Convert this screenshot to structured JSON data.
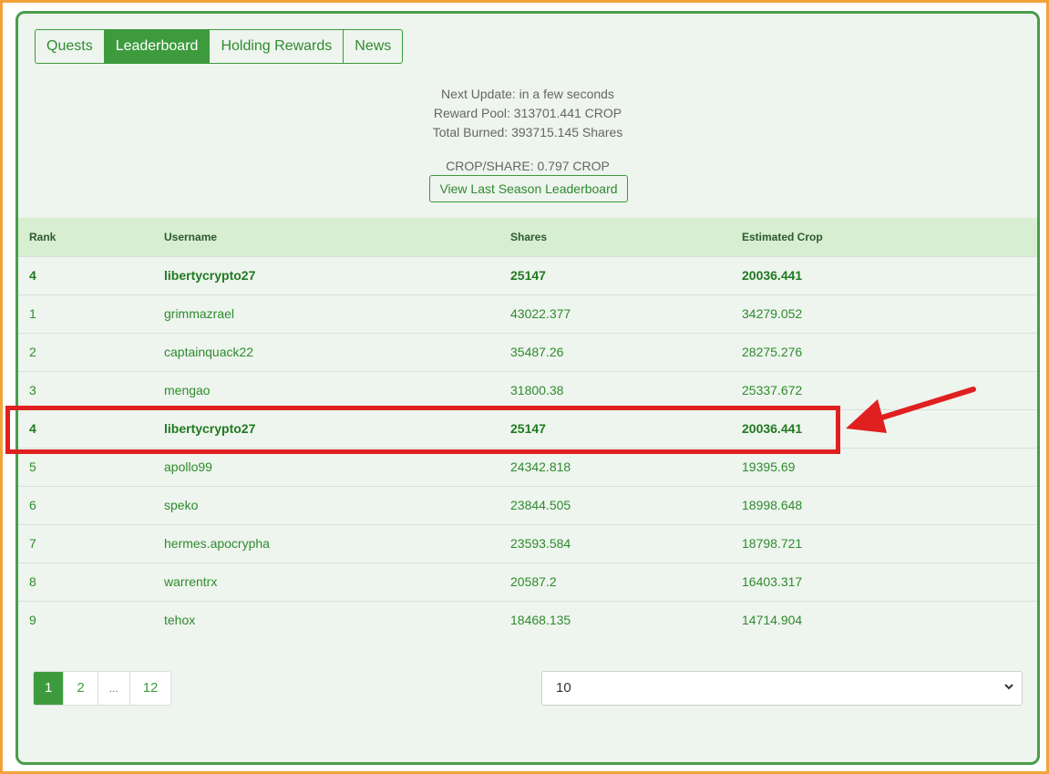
{
  "tabs": [
    {
      "label": "Quests"
    },
    {
      "label": "Leaderboard"
    },
    {
      "label": "Holding Rewards"
    },
    {
      "label": "News"
    }
  ],
  "info": {
    "next_update": "Next Update: in a few seconds",
    "reward_pool": "Reward Pool: 313701.441 CROP",
    "total_burned": "Total Burned: 393715.145 Shares",
    "crop_per_share": "CROP/SHARE: 0.797 CROP",
    "last_season_button": "View Last Season Leaderboard"
  },
  "table": {
    "headers": [
      "Rank",
      "Username",
      "Shares",
      "Estimated Crop"
    ],
    "rows": [
      [
        "4",
        "libertycrypto27",
        "25147",
        "20036.441"
      ],
      [
        "1",
        "grimmazrael",
        "43022.377",
        "34279.052"
      ],
      [
        "2",
        "captainquack22",
        "35487.26",
        "28275.276"
      ],
      [
        "3",
        "mengao",
        "31800.38",
        "25337.672"
      ],
      [
        "4",
        "libertycrypto27",
        "25147",
        "20036.441"
      ],
      [
        "5",
        "apollo99",
        "24342.818",
        "19395.69"
      ],
      [
        "6",
        "speko",
        "23844.505",
        "18998.648"
      ],
      [
        "7",
        "hermes.apocrypha",
        "23593.584",
        "18798.721"
      ],
      [
        "8",
        "warrentrx",
        "20587.2",
        "16403.317"
      ],
      [
        "9",
        "tehox",
        "18468.135",
        "14714.904"
      ]
    ]
  },
  "pagination": {
    "pages": [
      "1",
      "2",
      "...",
      "12"
    ],
    "active": "1"
  },
  "page_size": {
    "selected": "10"
  },
  "colors": {
    "accent": "#3d9b3d",
    "highlight": "#e01f1f",
    "frame": "#f2a23a"
  }
}
